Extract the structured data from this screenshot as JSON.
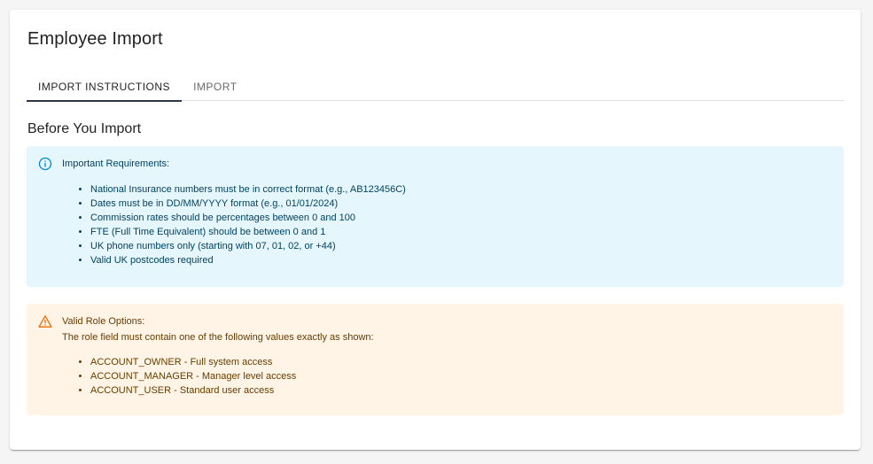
{
  "header": {
    "title": "Employee Import"
  },
  "tabs": [
    {
      "label": "IMPORT INSTRUCTIONS",
      "active": true
    },
    {
      "label": "IMPORT",
      "active": false
    }
  ],
  "section": {
    "title": "Before You Import"
  },
  "info_alert": {
    "icon": "info-icon",
    "title": "Important Requirements:",
    "items": [
      "National Insurance numbers must be in correct format (e.g., AB123456C)",
      "Dates must be in DD/MM/YYYY format (e.g., 01/01/2024)",
      "Commission rates should be percentages between 0 and 100",
      "FTE (Full Time Equivalent) should be between 0 and 1",
      "UK phone numbers only (starting with 07, 01, 02, or +44)",
      "Valid UK postcodes required"
    ]
  },
  "warning_alert": {
    "icon": "warning-icon",
    "title": "Valid Role Options:",
    "description": "The role field must contain one of the following values exactly as shown:",
    "items": [
      "ACCOUNT_OWNER - Full system access",
      "ACCOUNT_MANAGER - Manager level access",
      "ACCOUNT_USER - Standard user access"
    ]
  },
  "colors": {
    "info_bg": "#e5f6fd",
    "info_text": "#014361",
    "info_icon": "#0288d1",
    "warn_bg": "#fff4e5",
    "warn_text": "#663c00",
    "warn_icon": "#ed6c02",
    "tab_indicator": "#2d3748"
  }
}
